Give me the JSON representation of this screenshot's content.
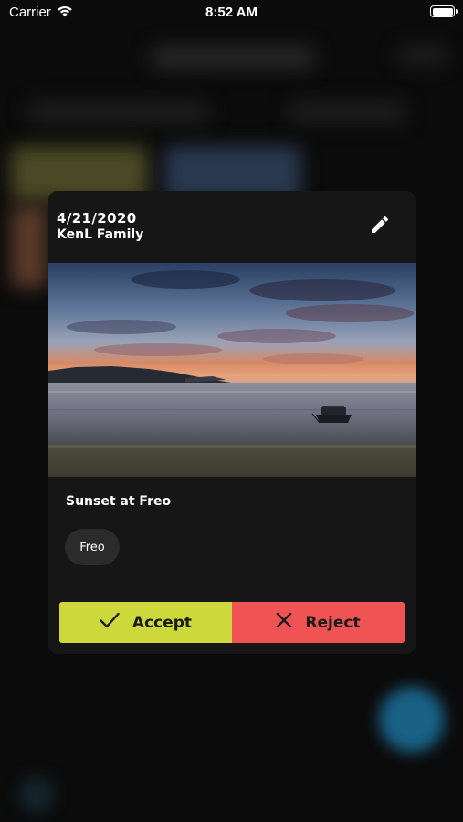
{
  "status_bar": {
    "carrier": "Carrier",
    "time": "8:52 AM"
  },
  "card": {
    "date": "4/21/2020",
    "album": "KenL Family",
    "photo": {
      "scene": "sunset-over-water",
      "sky_colors": [
        "#2c4466",
        "#6f87a6",
        "#d47a5a",
        "#e4a37c"
      ],
      "water_color": "#8c8f99"
    },
    "caption": "Sunset at Freo",
    "tag": "Freo",
    "accept_label": "Accept",
    "reject_label": "Reject"
  },
  "colors": {
    "accept": "#cdd93a",
    "reject": "#ef5353",
    "card_bg": "#161616",
    "chip_bg": "#2b2b2b"
  },
  "icons": {
    "edit": "pencil-icon",
    "accept": "checkmark-icon",
    "reject": "x-icon",
    "wifi": "wifi-icon",
    "battery": "battery-icon"
  }
}
